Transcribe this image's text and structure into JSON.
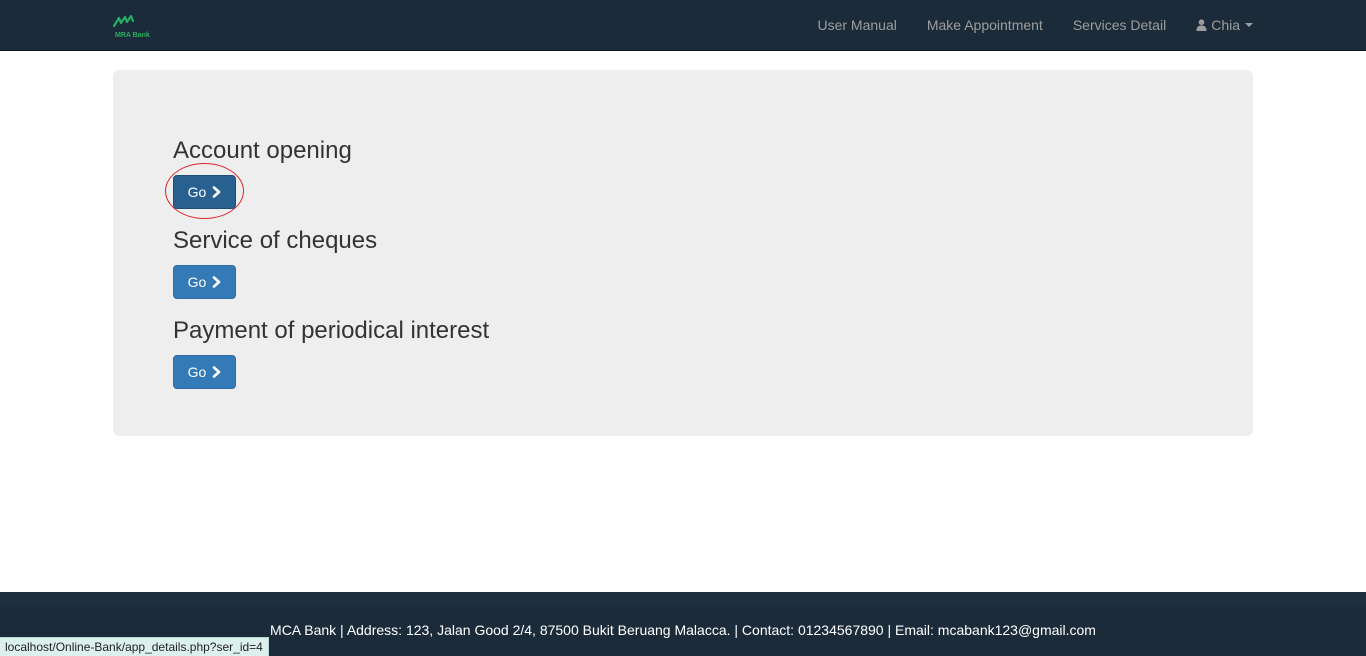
{
  "brand": {
    "name": "MRA Bank",
    "color": "#27ae60"
  },
  "nav": {
    "links": [
      {
        "label": "User Manual"
      },
      {
        "label": "Make Appointment"
      },
      {
        "label": "Services Detail"
      }
    ],
    "user": {
      "label": "Chia",
      "icon": "user-icon"
    }
  },
  "services": [
    {
      "title": "Account opening",
      "button_label": "Go"
    },
    {
      "title": "Service of cheques",
      "button_label": "Go"
    },
    {
      "title": "Payment of periodical interest",
      "button_label": "Go"
    }
  ],
  "footer": {
    "text": "MCA Bank | Address: 123, Jalan Good 2/4, 87500 Bukit Beruang Malacca. | Contact: 01234567890 | Email: mcabank123@gmail.com"
  },
  "status_bar": {
    "url": "localhost/Online-Bank/app_details.php?ser_id=4"
  },
  "colors": {
    "navbar": "#1b2b3a",
    "jumbotron": "#eeeeee",
    "button": "#337ab7",
    "highlight": "#d9262c"
  }
}
